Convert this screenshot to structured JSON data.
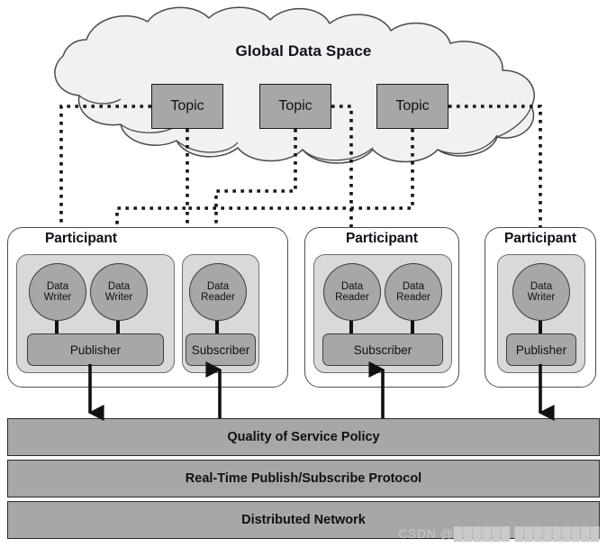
{
  "diagram": {
    "title": "Global Data Space",
    "watermark": "CSDN @██████ █████████",
    "colors": {
      "fill_mid_gray": "#a7a7a7",
      "fill_light_gray": "#d9d9d9",
      "cloud_fill": "#f1f1f1",
      "stroke_dark": "#1b1b1b",
      "background": "#ffffff"
    }
  },
  "topics": [
    {
      "label": "Topic"
    },
    {
      "label": "Topic"
    },
    {
      "label": "Topic"
    }
  ],
  "participants": [
    {
      "label": "Participant",
      "groups": [
        {
          "kind": "publisher",
          "container_label": "Publisher",
          "endpoints": [
            {
              "line1": "Data",
              "line2": "Writer"
            },
            {
              "line1": "Data",
              "line2": "Writer"
            }
          ]
        },
        {
          "kind": "subscriber",
          "container_label": "Subscriber",
          "endpoints": [
            {
              "line1": "Data",
              "line2": "Reader"
            }
          ]
        }
      ]
    },
    {
      "label": "Participant",
      "groups": [
        {
          "kind": "subscriber",
          "container_label": "Subscriber",
          "endpoints": [
            {
              "line1": "Data",
              "line2": "Reader"
            },
            {
              "line1": "Data",
              "line2": "Reader"
            }
          ]
        }
      ]
    },
    {
      "label": "Participant",
      "groups": [
        {
          "kind": "publisher",
          "container_label": "Publisher",
          "endpoints": [
            {
              "line1": "Data",
              "line2": "Writer"
            }
          ]
        }
      ]
    }
  ],
  "stack_layers": [
    {
      "label": "Quality of Service Policy"
    },
    {
      "label": "Real-Time Publish/Subscribe Protocol"
    },
    {
      "label": "Distributed Network"
    }
  ]
}
